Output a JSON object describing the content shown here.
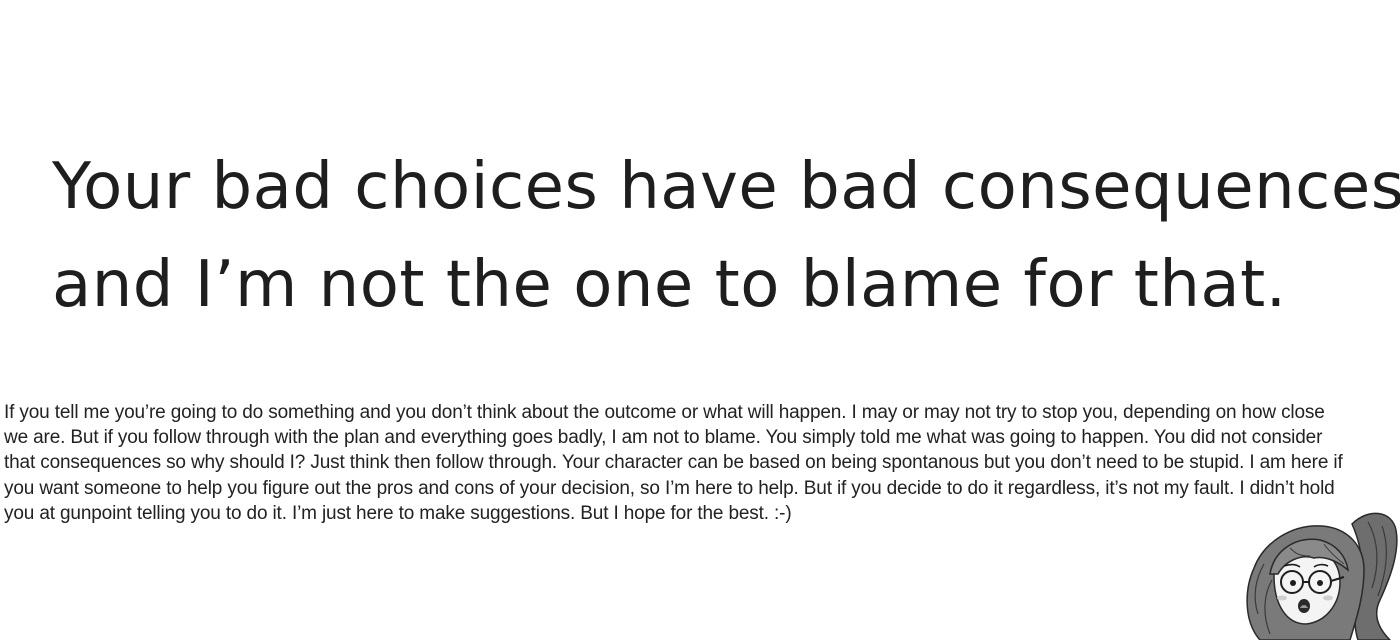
{
  "headline": {
    "line1": "Your bad choices have bad consequences",
    "line2": "and I’m not the one to blame for that."
  },
  "body": {
    "lines": [
      "If you tell me you’re going to do something and you don’t think about the outcome or what will happen. I may or may not try to stop you, depending on how close",
      "we are. But if you follow through with the plan and everything goes badly, I am not to blame. You simply told me what was going to happen. You did not consider",
      "that consequences so why should I? Just think then follow through. Your character can be based on being spontanous but you don’t need to be stupid. I am here if",
      "you want someone to help you figure out the pros and cons of your decision, so I’m here to help. But if you decide to do it regardless, it’s not my fault. I didn’t hold",
      "you at gunpoint telling you to do it. I’m just here to make suggestions. But I hope for the best. :-)"
    ]
  },
  "colors": {
    "text": "#1e1e1e",
    "background": "#ffffff"
  }
}
